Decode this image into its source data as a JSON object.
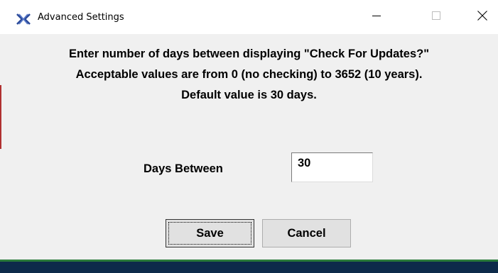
{
  "window": {
    "title": "Advanced Settings",
    "icon": "app-logo-icon"
  },
  "titlebar_buttons": {
    "minimize_icon": "minimize-icon",
    "maximize_icon": "maximize-icon",
    "close_icon": "close-icon"
  },
  "message": {
    "line1": "Enter number of days between displaying \"Check For Updates?\"",
    "line2": "Acceptable values are from 0 (no checking) to 3652 (10 years).",
    "line3": "Default value is 30 days."
  },
  "form": {
    "days_label": "Days Between",
    "days_value": "30"
  },
  "buttons": {
    "save_label": "Save",
    "cancel_label": "Cancel"
  },
  "colors": {
    "bottom_bar": "#0d2a4a",
    "bottom_bar_accent": "#2a7a3a",
    "icon_blue": "#2b4a9a"
  }
}
